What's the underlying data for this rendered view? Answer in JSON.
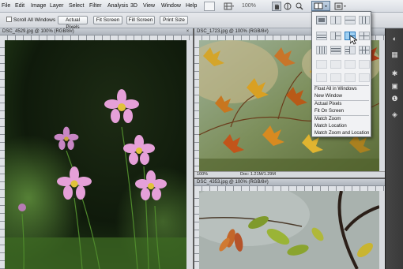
{
  "menubar": {
    "items": [
      "File",
      "Edit",
      "Image",
      "Layer",
      "Select",
      "Filter",
      "Analysis",
      "3D",
      "View",
      "Window",
      "Help"
    ],
    "zoom": "100%"
  },
  "options": {
    "scroll_all_label": "Scroll All Windows",
    "buttons": [
      "Actual Pixels",
      "Fit Screen",
      "Fill Screen",
      "Print Size"
    ]
  },
  "documents": [
    {
      "title": "DSC_4529.jpg @ 100% (RGB/8#)"
    },
    {
      "title": "DSC_1723.jpg @ 100% (RGB/8#)",
      "zoom": "100%",
      "doc_size": "Doc: 1.21M/1.29M"
    },
    {
      "title": "DSC_4353.jpg @ 100% (RGB/8#)"
    }
  ],
  "arrange_menu": {
    "items": [
      "Float All in Windows",
      "New Window",
      "Actual Pixels",
      "Fit On Screen",
      "Match Zoom",
      "Match Location",
      "Match Zoom and Location"
    ]
  },
  "icons": {
    "tools": [
      "hand-icon",
      "rotate-view-icon",
      "zoom-icon",
      "screen-mode-icon",
      "arrange-documents-icon"
    ],
    "dock": [
      "color-icon",
      "swatches-icon",
      "adjustments-icon",
      "masks-icon",
      "info-icon",
      "layers-icon"
    ]
  }
}
